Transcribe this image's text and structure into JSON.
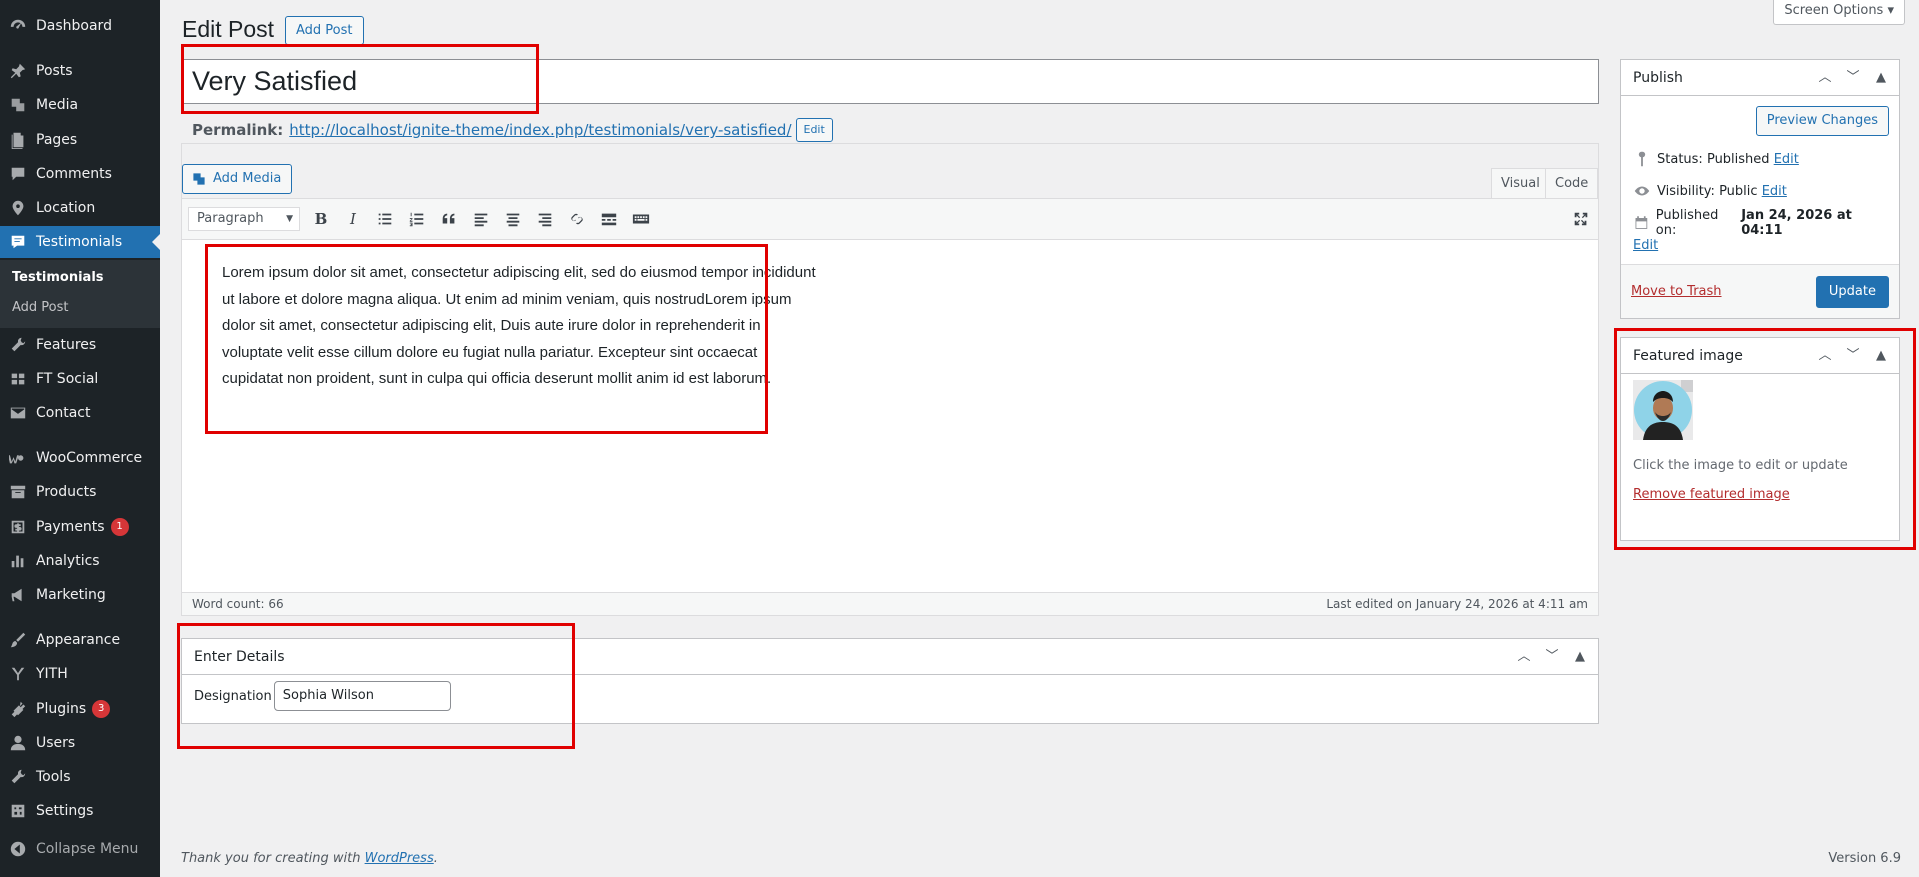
{
  "sidebar": {
    "items": [
      {
        "label": "Dashboard",
        "icon": "dashboard-icon"
      },
      {
        "label": "Posts",
        "icon": "pin-icon"
      },
      {
        "label": "Media",
        "icon": "media-icon"
      },
      {
        "label": "Pages",
        "icon": "pages-icon"
      },
      {
        "label": "Comments",
        "icon": "comments-icon"
      },
      {
        "label": "Location",
        "icon": "location-icon"
      },
      {
        "label": "Testimonials",
        "icon": "testimonials-icon"
      },
      {
        "label": "Features",
        "icon": "wrench-icon"
      },
      {
        "label": "FT Social",
        "icon": "social-icon"
      },
      {
        "label": "Contact",
        "icon": "mail-icon"
      },
      {
        "label": "WooCommerce",
        "icon": "woo-icon"
      },
      {
        "label": "Products",
        "icon": "archive-icon"
      },
      {
        "label": "Payments",
        "icon": "dollar-icon",
        "badge": "1"
      },
      {
        "label": "Analytics",
        "icon": "bar-chart-icon"
      },
      {
        "label": "Marketing",
        "icon": "megaphone-icon"
      },
      {
        "label": "Appearance",
        "icon": "brush-icon"
      },
      {
        "label": "YITH",
        "icon": "yith-icon"
      },
      {
        "label": "Plugins",
        "icon": "plugin-icon",
        "badge": "3"
      },
      {
        "label": "Users",
        "icon": "user-icon"
      },
      {
        "label": "Tools",
        "icon": "wrench-icon"
      },
      {
        "label": "Settings",
        "icon": "settings-icon"
      }
    ],
    "submenu": [
      "Testimonials",
      "Add Post"
    ],
    "collapse_label": "Collapse Menu"
  },
  "header": {
    "screen_options": "Screen Options ▾",
    "title": "Edit Post",
    "add_post": "Add Post"
  },
  "post": {
    "title": "Very Satisfied",
    "permalink_label": "Permalink:",
    "permalink_url": "http://localhost/ignite-theme/index.php/testimonials/very-satisfied/",
    "permalink_edit": "Edit"
  },
  "editor": {
    "add_media": "Add Media",
    "tab_visual": "Visual",
    "tab_code": "Code",
    "format": "Paragraph",
    "content": "Lorem ipsum dolor sit amet, consectetur adipiscing elit, sed do eiusmod tempor incididunt ut labore et dolore magna aliqua. Ut enim ad minim veniam, quis nostrudLorem ipsum dolor sit amet, consectetur adipiscing elit, Duis aute irure dolor in reprehenderit in voluptate velit esse cillum dolore eu fugiat nulla pariatur. Excepteur sint occaecat cupidatat non proident, sunt in culpa qui officia deserunt mollit anim id est laborum.",
    "word_count": "Word count: 66",
    "last_edited": "Last edited on January 24, 2026 at 4:11 am"
  },
  "details": {
    "title": "Enter Details",
    "designation_label": "Designation",
    "designation_value": "Sophia Wilson"
  },
  "publish": {
    "title": "Publish",
    "preview": "Preview Changes",
    "status_label": "Status:",
    "status_value": "Published",
    "visibility_label": "Visibility:",
    "visibility_value": "Public",
    "published_label": "Published on:",
    "published_value": "Jan 24, 2026 at 04:11",
    "edit": "Edit",
    "trash": "Move to Trash",
    "update": "Update"
  },
  "featured": {
    "title": "Featured image",
    "hint": "Click the image to edit or update",
    "remove": "Remove featured image"
  },
  "footer": {
    "thanks_prefix": "Thank you for creating with",
    "wp": "WordPress",
    "suffix": ".",
    "version": "Version 6.9"
  },
  "colors": {
    "sidebar_bg": "#1d2327",
    "accent": "#2271b1",
    "highlight": "#e00000"
  }
}
